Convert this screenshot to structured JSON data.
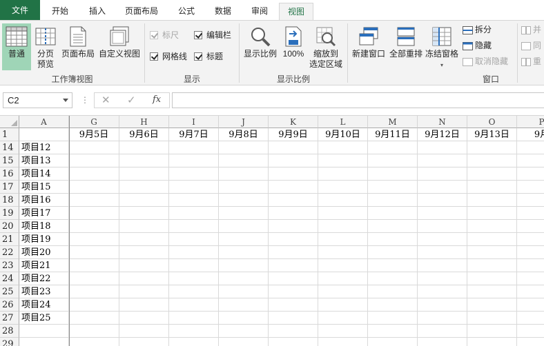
{
  "ribbon_tabs": [
    {
      "label": "文件"
    },
    {
      "label": "开始"
    },
    {
      "label": "插入"
    },
    {
      "label": "页面布局"
    },
    {
      "label": "公式"
    },
    {
      "label": "数据"
    },
    {
      "label": "审阅"
    },
    {
      "label": "视图"
    }
  ],
  "active_tab": "视图",
  "groups": {
    "workbook_views": {
      "label": "工作簿视图",
      "normal": "普通",
      "page_break_line1": "分页",
      "page_break_line2": "预览",
      "page_layout": "页面布局",
      "custom_views": "自定义视图"
    },
    "show": {
      "label": "显示",
      "ruler": "标尺",
      "formula_bar": "编辑栏",
      "gridlines": "网格线",
      "headings": "标题"
    },
    "zoom": {
      "label": "显示比例",
      "zoom": "显示比例",
      "zoom100": "100%",
      "zoom_sel_line1": "缩放到",
      "zoom_sel_line2": "选定区域"
    },
    "window": {
      "label": "窗口",
      "new_window": "新建窗口",
      "arrange_all": "全部重排",
      "freeze_panes": "冻结窗格",
      "split": "拆分",
      "hide": "隐藏",
      "unhide": "取消隐藏",
      "side_by_side": "并",
      "sync_scroll": "同",
      "reset_pos": "重"
    }
  },
  "formula_bar": {
    "name_box": "C2",
    "fx": "fx",
    "cancel": "✕",
    "enter": "✓",
    "dots": "⋮",
    "value": ""
  },
  "sheet": {
    "corner": "",
    "columns": [
      "A",
      "G",
      "H",
      "I",
      "J",
      "K",
      "L",
      "M",
      "N",
      "O",
      "P"
    ],
    "rows": [
      {
        "num": "1",
        "a": "",
        "dates": [
          "9月5日",
          "9月6日",
          "9月7日",
          "9月8日",
          "9月9日",
          "9月10日",
          "9月11日",
          "9月12日",
          "9月13日",
          "9月"
        ]
      },
      {
        "num": "14",
        "a": "项目12"
      },
      {
        "num": "15",
        "a": "项目13"
      },
      {
        "num": "16",
        "a": "项目14"
      },
      {
        "num": "17",
        "a": "项目15"
      },
      {
        "num": "18",
        "a": "项目16"
      },
      {
        "num": "19",
        "a": "项目17"
      },
      {
        "num": "20",
        "a": "项目18"
      },
      {
        "num": "21",
        "a": "项目19"
      },
      {
        "num": "22",
        "a": "项目20"
      },
      {
        "num": "23",
        "a": "项目21"
      },
      {
        "num": "24",
        "a": "项目22"
      },
      {
        "num": "25",
        "a": "项目23"
      },
      {
        "num": "26",
        "a": "项目24"
      },
      {
        "num": "27",
        "a": "项目25"
      },
      {
        "num": "28",
        "a": ""
      },
      {
        "num": "29",
        "a": ""
      }
    ]
  },
  "colors": {
    "accent": "#217346",
    "selected_button": "#9fd5b7",
    "ribbon_bg": "#f3f3f3"
  }
}
